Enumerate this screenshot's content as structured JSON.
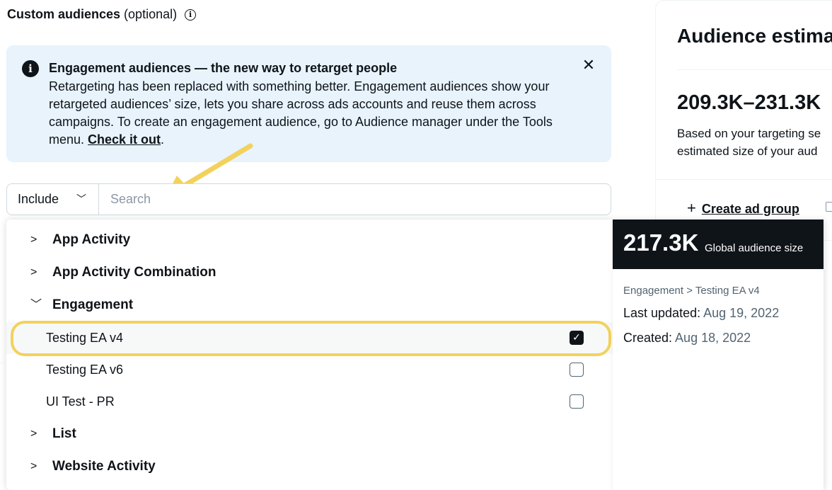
{
  "section": {
    "title_strong": "Custom audiences",
    "title_light": " (optional)",
    "info_icon": "info-icon"
  },
  "banner": {
    "title": "Engagement audiences — the new way to retarget people",
    "body": "Retargeting has been replaced with something better. Engagement audiences show your retargeted audiences’ size, lets you share across ads accounts and reuse them across campaigns. To create an engagement audience, go to Audience manager under the Tools menu. ",
    "link": "Check it out",
    "link_suffix": ".",
    "close_icon": "close-icon"
  },
  "filter": {
    "include_label": "Include",
    "search_placeholder": "Search"
  },
  "categories": [
    {
      "label": "App Activity",
      "expanded": false
    },
    {
      "label": "App Activity Combination",
      "expanded": false
    },
    {
      "label": "Engagement",
      "expanded": true
    },
    {
      "label": "List",
      "expanded": false
    },
    {
      "label": "Website Activity",
      "expanded": false
    }
  ],
  "engagement_options": [
    {
      "label": "Testing EA v4",
      "checked": true
    },
    {
      "label": "Testing EA v6",
      "checked": false
    },
    {
      "label": "UI Test - PR",
      "checked": false
    }
  ],
  "estimate": {
    "title": "Audience estima",
    "range": "209.3K–231.3K",
    "desc_line1": "Based on your targeting se",
    "desc_line2": "estimated size of your aud",
    "create_label": "Create ad group"
  },
  "detail": {
    "size": "217.3K",
    "size_label": "Global audience size",
    "path": "Engagement > Testing EA v4",
    "updated_label": "Last updated: ",
    "updated_value": "Aug 19, 2022",
    "created_label": "Created: ",
    "created_value": "Aug 18, 2022"
  },
  "colors": {
    "banner_bg": "#e8f3fc",
    "highlight": "#f2d25c",
    "text": "#0f1419",
    "muted": "#536471"
  }
}
